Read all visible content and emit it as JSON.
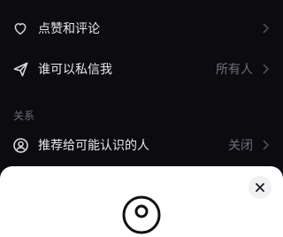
{
  "settings": {
    "likes_comments": {
      "label": "点赞和评论",
      "icon": "heart-icon"
    },
    "who_can_dm": {
      "label": "谁可以私信我",
      "value": "所有人",
      "icon": "send-icon"
    },
    "relations_section": "关系",
    "recommend_to_contacts": {
      "label": "推荐给可能认识的人",
      "value": "关闭",
      "icon": "user-icon"
    }
  },
  "sheet": {
    "close_icon": "close-icon"
  },
  "colors": {
    "background": "#0b0b10",
    "text_primary": "#e7e7ec",
    "text_secondary": "#6f7079",
    "sheet_background": "#ffffff"
  }
}
